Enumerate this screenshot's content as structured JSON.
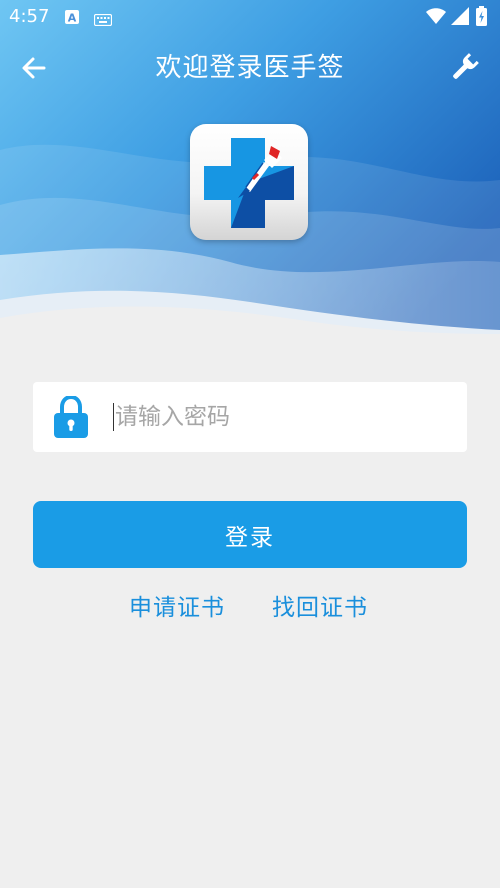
{
  "status_bar": {
    "time": "4:57",
    "icons": [
      "a-notification-icon",
      "keyboard-icon",
      "wifi-icon",
      "signal-icon",
      "battery-charging-icon"
    ]
  },
  "app_bar": {
    "back_icon": "arrow-left-icon",
    "title": "欢迎登录医手签",
    "settings_icon": "wrench-icon"
  },
  "logo": {
    "icon": "medical-cross-pen-logo"
  },
  "password": {
    "icon": "lock-icon",
    "placeholder": "请输入密码",
    "value": ""
  },
  "login_button": {
    "label": "登录"
  },
  "links": {
    "apply_cert": "申请证书",
    "recover_cert": "找回证书"
  },
  "colors": {
    "primary": "#1a9ce6",
    "link": "#1a8fdc",
    "background": "#efefef",
    "hero_blue": "#1e6fc0"
  }
}
